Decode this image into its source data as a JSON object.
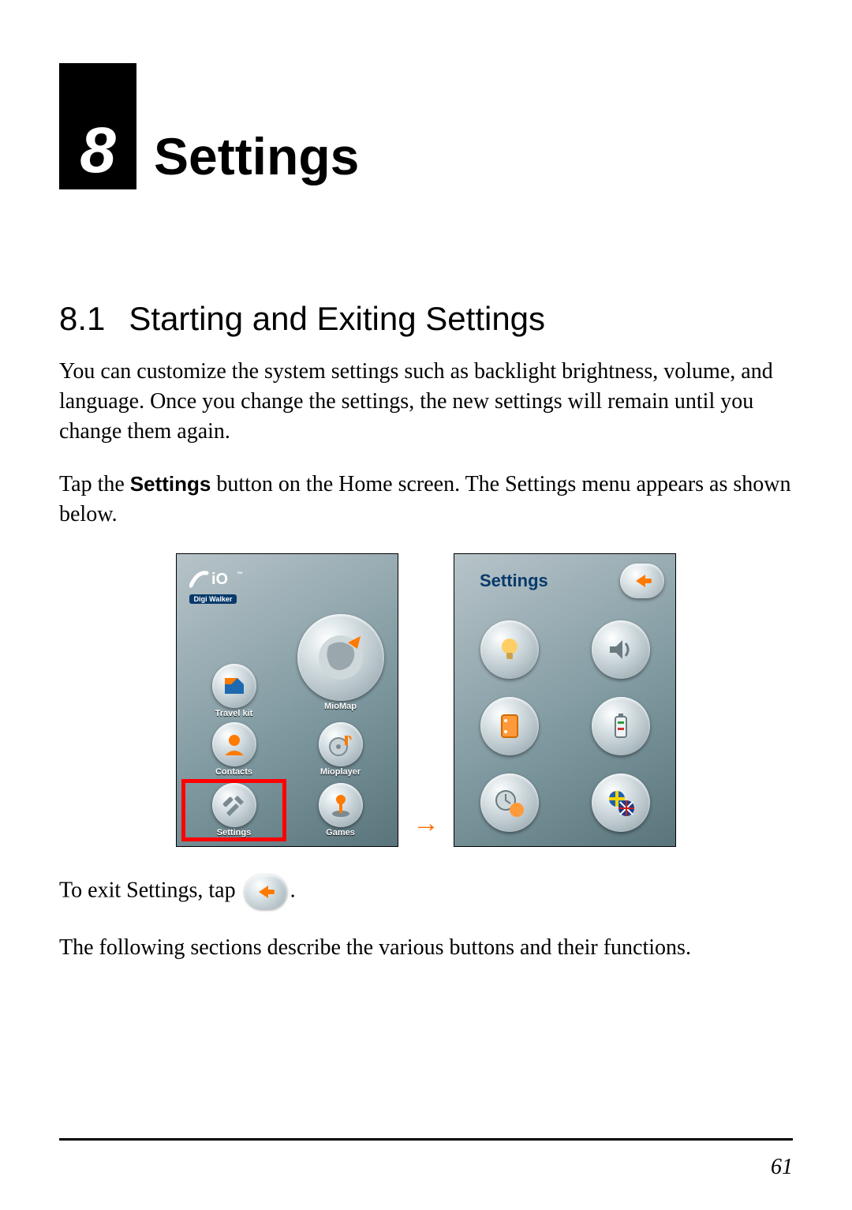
{
  "chapter": {
    "number": "8",
    "title": "Settings"
  },
  "section": {
    "number": "8.1",
    "title": "Starting and Exiting Settings"
  },
  "paragraphs": {
    "intro": "You can customize the system settings such as backlight brightness, volume, and language. Once you change the settings, the new settings will remain until you change them again.",
    "tap_prefix": "Tap the ",
    "tap_button_word": "Settings",
    "tap_suffix": " button on the Home screen. The Settings menu appears as shown below.",
    "exit_prefix": "To exit Settings, tap ",
    "exit_suffix": ".",
    "following": "The following sections describe the various buttons and their functions."
  },
  "home_screen": {
    "logo_top": "miO™",
    "logo_sub": "Digi Walker",
    "items": [
      {
        "label": "",
        "icon": "photos-icon"
      },
      {
        "label": "MioMap",
        "icon": "globe-icon"
      },
      {
        "label": "Travel kit",
        "icon": "shapes-icon"
      },
      {
        "label": "",
        "icon": "music-icon"
      },
      {
        "label": "Contacts",
        "icon": "person-icon"
      },
      {
        "label": "Mioplayer",
        "icon": "disc-icon"
      },
      {
        "label": "Settings",
        "icon": "tools-icon"
      },
      {
        "label": "Games",
        "icon": "joystick-icon"
      }
    ],
    "highlight_index": 6
  },
  "settings_screen": {
    "title": "Settings",
    "items": [
      {
        "icon": "bulb-icon"
      },
      {
        "icon": "volume-icon"
      },
      {
        "icon": "screen-icon"
      },
      {
        "icon": "power-icon"
      },
      {
        "icon": "clock-globe-icon"
      },
      {
        "icon": "flag-icon"
      }
    ]
  },
  "arrow_glyph": "→",
  "page_number": "61"
}
